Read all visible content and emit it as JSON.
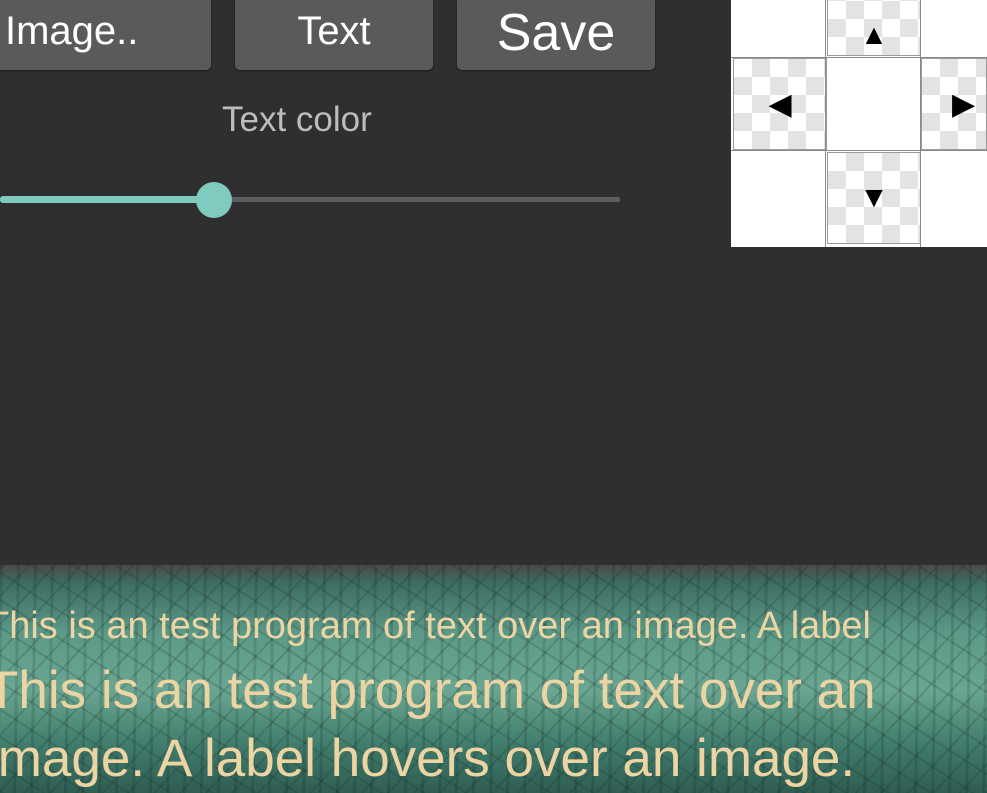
{
  "toolbar": {
    "image_label": "Image..",
    "text_label": "Text",
    "save_label": "Save"
  },
  "color_control": {
    "label": "Text color",
    "slider_value": 0.345,
    "accent_color": "#7fcbc0"
  },
  "dpad": {
    "up_icon": "▲",
    "left_icon": "◀",
    "right_icon": "▶",
    "down_icon": "▼"
  },
  "image_overlay": {
    "text_color": "#ecd4a3",
    "small_text": "This is an test program of text over an image. A label",
    "large_text": "This is an test program of text over an image. A label hovers over an image."
  }
}
